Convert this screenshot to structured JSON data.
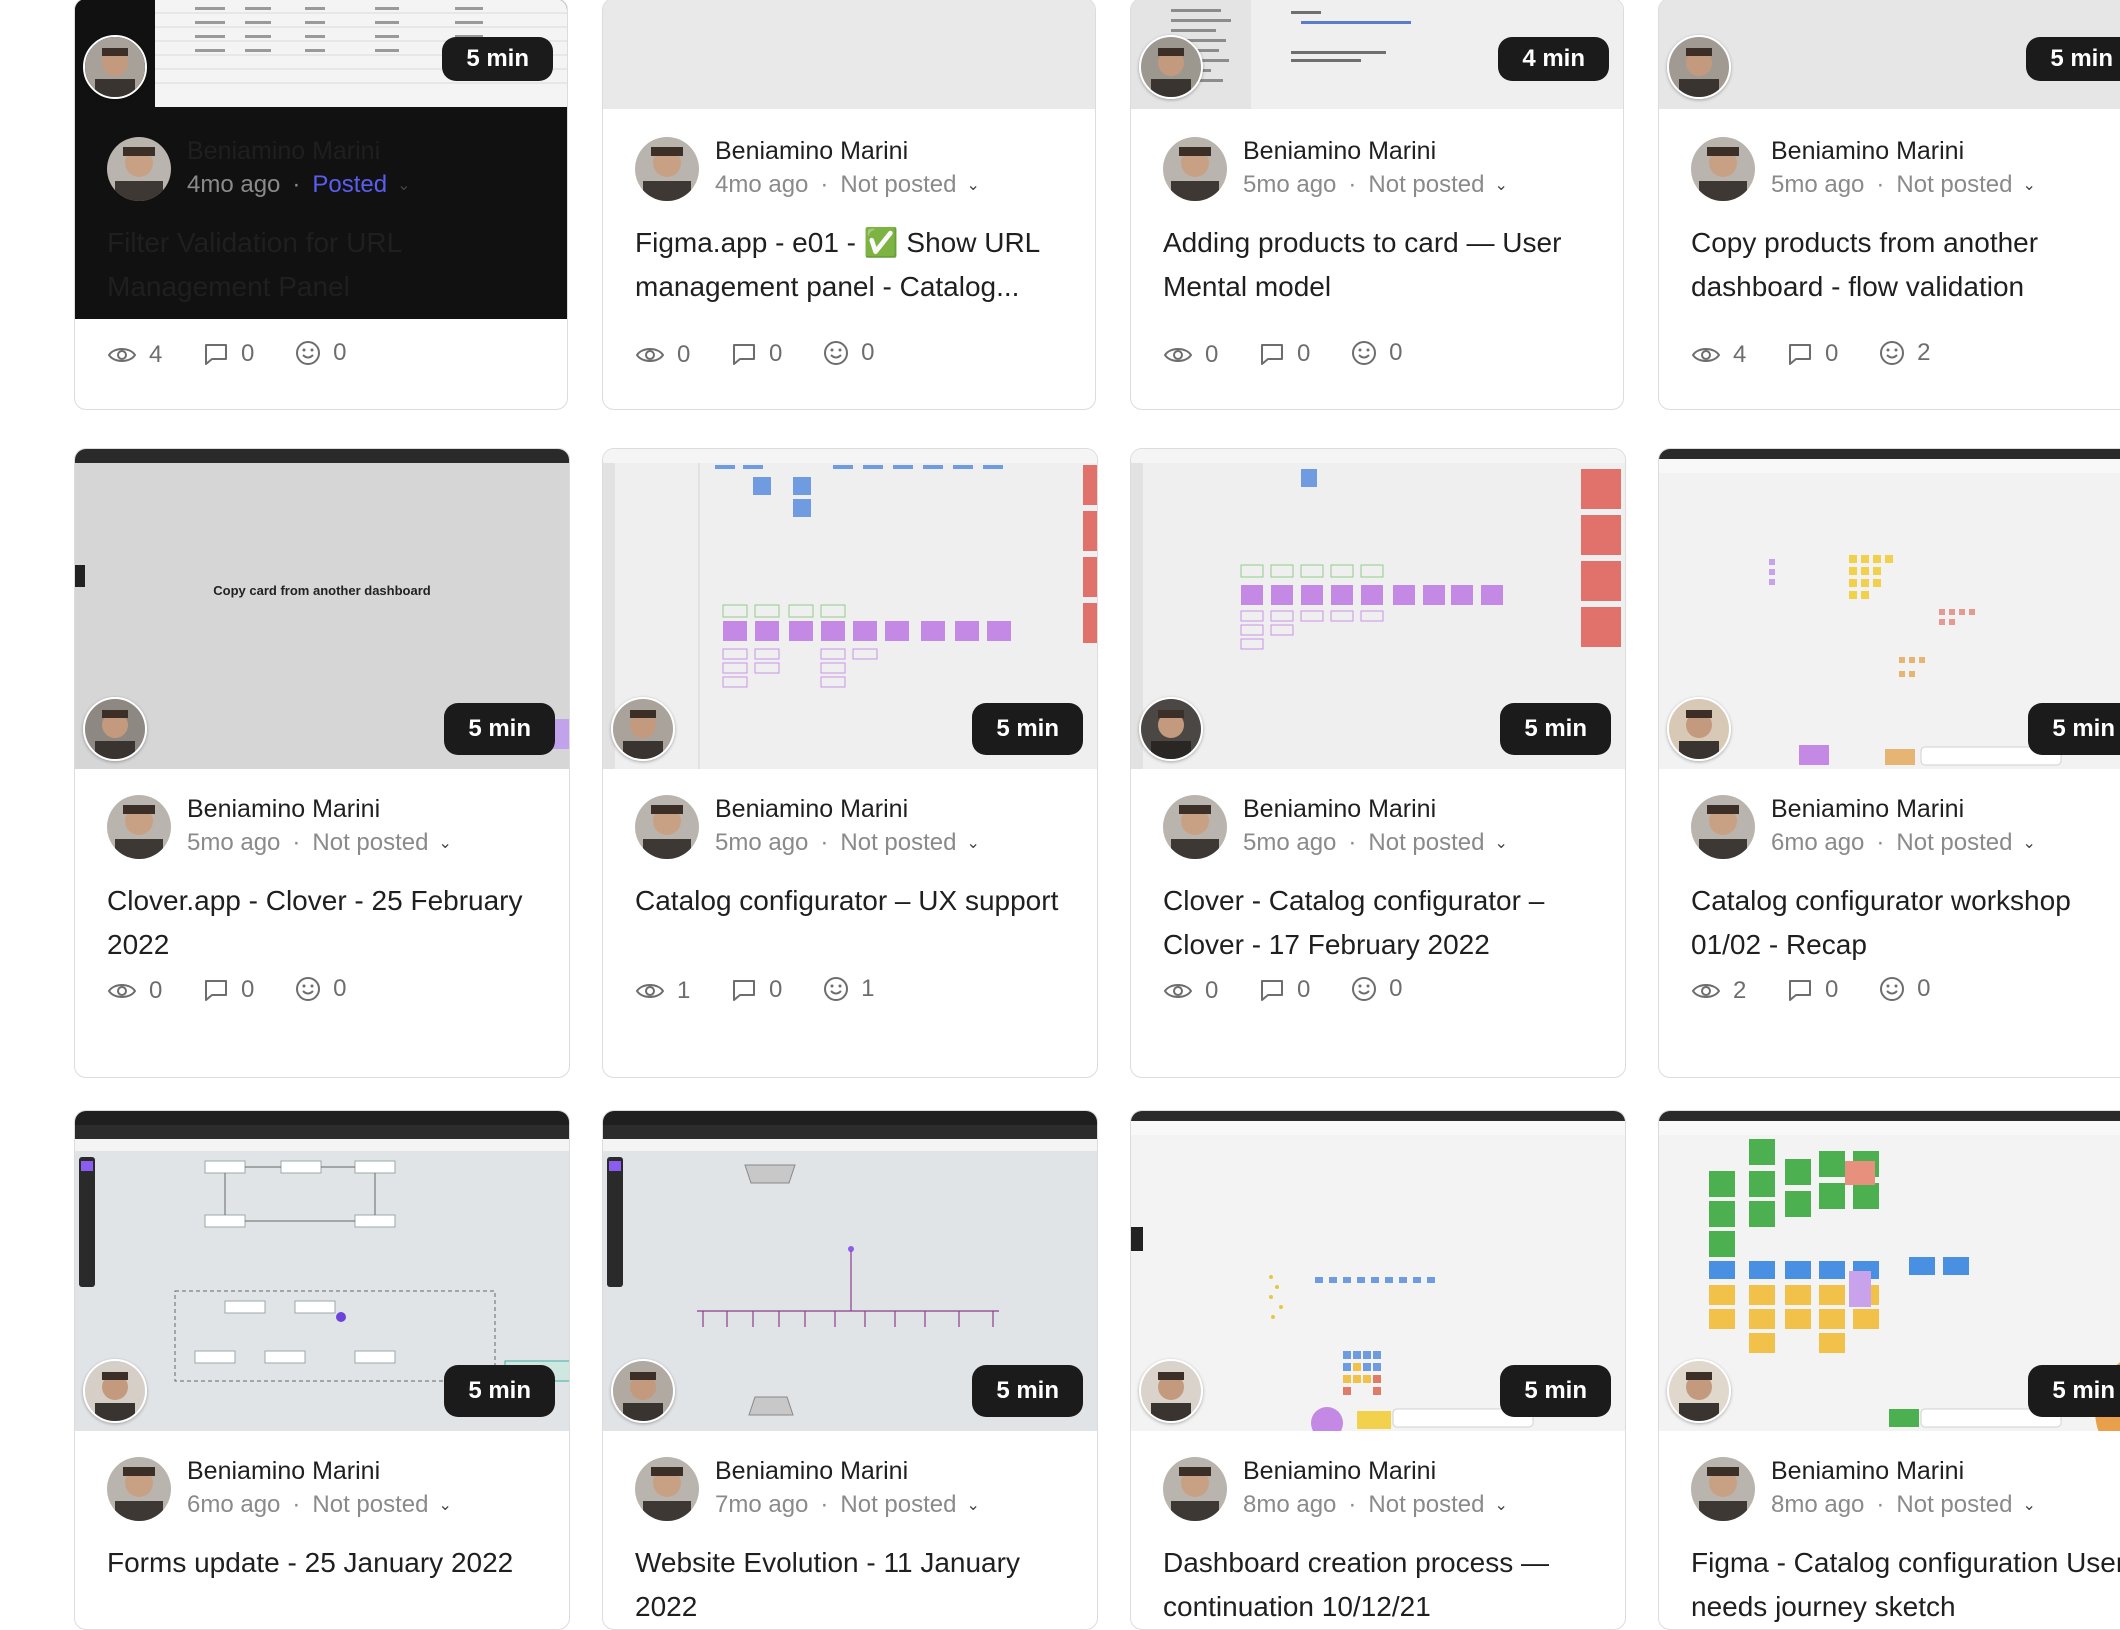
{
  "videos": [
    {
      "author": "Beniamino Marini",
      "age": "4mo ago",
      "status": "Posted",
      "duration": "5 min",
      "title": "Filter Validation for URL Management Panel",
      "views": "4",
      "comments": "0",
      "reactions": "0"
    },
    {
      "author": "Beniamino Marini",
      "age": "4mo ago",
      "status": "Not posted",
      "duration": "",
      "title": "Figma.app - e01 - ✅ Show URL management panel - Catalog...",
      "views": "0",
      "comments": "0",
      "reactions": "0"
    },
    {
      "author": "Beniamino Marini",
      "age": "5mo ago",
      "status": "Not posted",
      "duration": "4 min",
      "title": "Adding products to card — User Mental model",
      "views": "0",
      "comments": "0",
      "reactions": "0"
    },
    {
      "author": "Beniamino Marini",
      "age": "5mo ago",
      "status": "Not posted",
      "duration": "5 min",
      "title": "Copy products from another dashboard - flow validation",
      "views": "4",
      "comments": "0",
      "reactions": "2"
    },
    {
      "author": "Beniamino Marini",
      "age": "5mo ago",
      "status": "Not posted",
      "duration": "5 min",
      "title": "Clover.app - Clover - 25 February 2022",
      "views": "0",
      "comments": "0",
      "reactions": "0",
      "thumb_text": "Copy card from another dashboard"
    },
    {
      "author": "Beniamino Marini",
      "age": "5mo ago",
      "status": "Not posted",
      "duration": "5 min",
      "title": "Catalog configurator – UX support",
      "views": "1",
      "comments": "0",
      "reactions": "1"
    },
    {
      "author": "Beniamino Marini",
      "age": "5mo ago",
      "status": "Not posted",
      "duration": "5 min",
      "title": "Clover - Catalog configurator – Clover - 17 February 2022",
      "views": "0",
      "comments": "0",
      "reactions": "0"
    },
    {
      "author": "Beniamino Marini",
      "age": "6mo ago",
      "status": "Not posted",
      "duration": "5 min",
      "title": "Catalog configurator workshop 01/02 - Recap",
      "views": "2",
      "comments": "0",
      "reactions": "0"
    },
    {
      "author": "Beniamino Marini",
      "age": "6mo ago",
      "status": "Not posted",
      "duration": "5 min",
      "title": "Forms update - 25 January 2022",
      "views": "",
      "comments": "",
      "reactions": ""
    },
    {
      "author": "Beniamino Marini",
      "age": "7mo ago",
      "status": "Not posted",
      "duration": "5 min",
      "title": "Website Evolution - 11 January 2022",
      "views": "",
      "comments": "",
      "reactions": ""
    },
    {
      "author": "Beniamino Marini",
      "age": "8mo ago",
      "status": "Not posted",
      "duration": "5 min",
      "title": "Dashboard creation process — continuation 10/12/21",
      "views": "",
      "comments": "",
      "reactions": ""
    },
    {
      "author": "Beniamino Marini",
      "age": "8mo ago",
      "status": "Not posted",
      "duration": "5 min",
      "title": "Figma - Catalog configuration User needs journey sketch",
      "views": "",
      "comments": "",
      "reactions": ""
    }
  ],
  "colors": {
    "accent": "#5a5df0",
    "badge": "#1b1b1b",
    "border": "#dcdcdc",
    "muted": "#8a8a8a"
  },
  "icons": {
    "views": "eye-icon",
    "comments": "comment-icon",
    "reactions": "smiley-icon",
    "status": "chevron-down-icon"
  }
}
